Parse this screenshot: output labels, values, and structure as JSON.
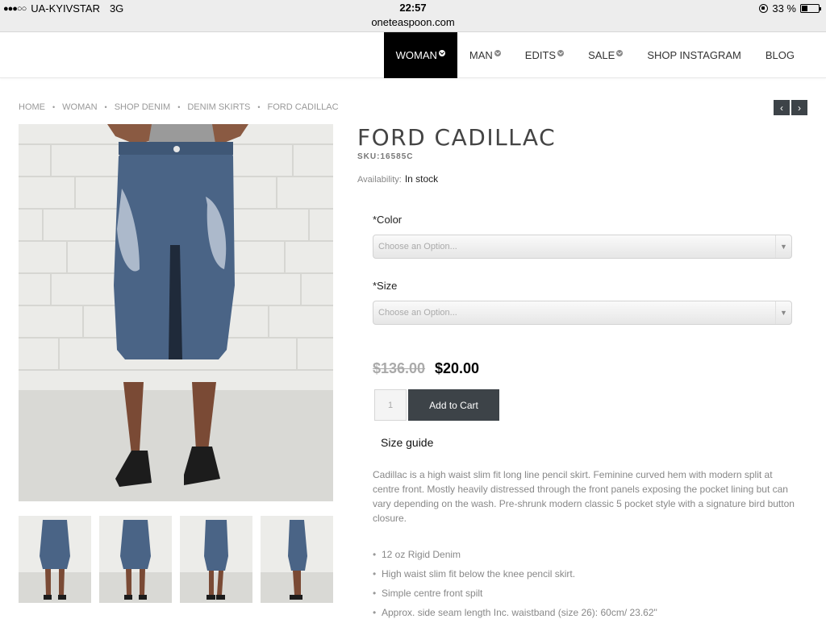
{
  "status_bar": {
    "carrier": "UA-KYIVSTAR",
    "network": "3G",
    "time": "22:57",
    "url": "oneteaspoon.com",
    "battery": "33 %",
    "battery_level": 0.33
  },
  "nav": {
    "items": [
      {
        "label": "WOMAN",
        "dropdown": true,
        "active": true
      },
      {
        "label": "MAN",
        "dropdown": true,
        "active": false
      },
      {
        "label": "EDITS",
        "dropdown": true,
        "active": false
      },
      {
        "label": "SALE",
        "dropdown": true,
        "active": false
      },
      {
        "label": "SHOP INSTAGRAM",
        "dropdown": false,
        "active": false
      },
      {
        "label": "BLOG",
        "dropdown": false,
        "active": false
      }
    ]
  },
  "breadcrumb": [
    "HOME",
    "WOMAN",
    "SHOP DENIM",
    "DENIM SKIRTS",
    "FORD CADILLAC"
  ],
  "pager": {
    "prev": "‹",
    "next": "›"
  },
  "product": {
    "title": "FORD CADILLAC",
    "sku": "SKU:16585C",
    "availability_label": "Availability:",
    "availability_value": "In stock",
    "color_label": "*Color",
    "color_placeholder": "Choose an Option...",
    "size_label": "*Size",
    "size_placeholder": "Choose an Option...",
    "old_price": "$136.00",
    "new_price": "$20.00",
    "quantity": "1",
    "add_to_cart": "Add to Cart",
    "size_guide": "Size guide",
    "description": "Cadillac is a high waist slim fit long line pencil skirt. Feminine curved hem with modern split at centre front. Mostly heavily distressed through the front panels exposing the pocket lining but can vary depending on the wash. Pre-shrunk modern classic 5 pocket style with a signature bird button closure.",
    "features": [
      "12 oz Rigid Denim",
      "High waist slim fit below the knee pencil skirt.",
      "Simple centre front spilt",
      "Approx. side seam length Inc. waistband (size 26): 60cm/ 23.62\""
    ]
  },
  "colors": {
    "nav_active_bg": "#000000",
    "button_bg": "#3d4348",
    "denim": "#4a6486"
  }
}
